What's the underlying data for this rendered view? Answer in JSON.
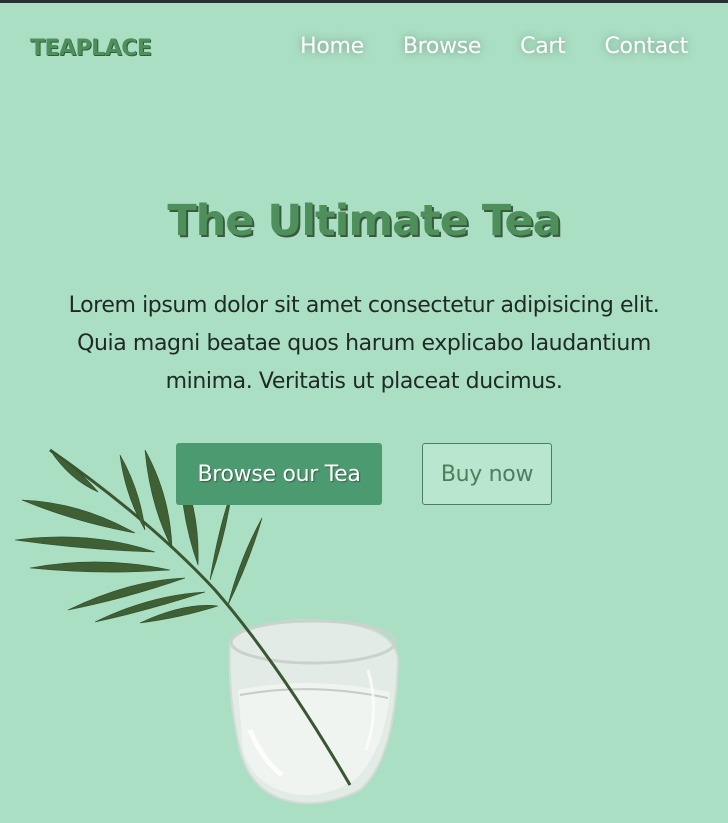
{
  "brand": {
    "logo": "TEAPLACE"
  },
  "nav": {
    "items": [
      "Home",
      "Browse",
      "Cart",
      "Contact"
    ]
  },
  "hero": {
    "title": "The Ultimate Tea",
    "text": "Lorem ipsum dolor sit amet consectetur adipisicing elit. Quia magni beatae quos harum explicabo laudantium minima. Veritatis ut placeat ducimus.",
    "primary_button": "Browse our Tea",
    "secondary_button": "Buy now"
  },
  "colors": {
    "background": "#abdfc4",
    "accent": "#4c9a70",
    "brand_text": "#4f8f5b"
  },
  "icons": {
    "illustration": "palm-leaf-in-glass-icon"
  }
}
